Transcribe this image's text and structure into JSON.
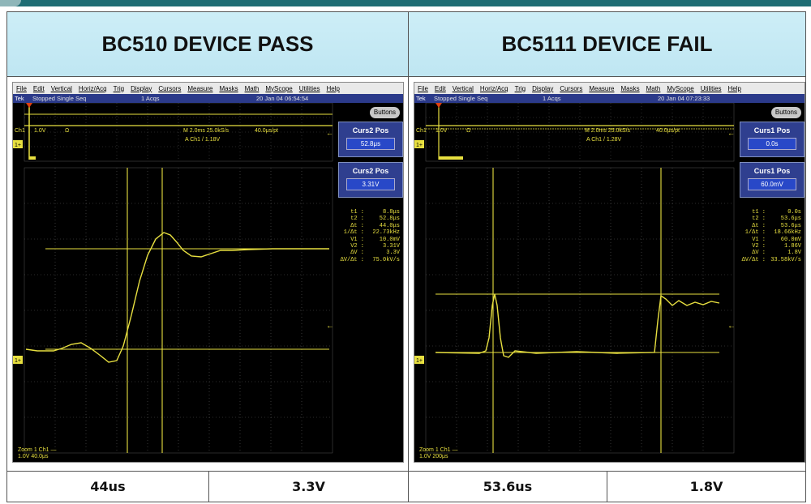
{
  "left": {
    "title": "BC510 DEVICE PASS",
    "footer": [
      "44us",
      "3.3V"
    ],
    "scope": {
      "menu": [
        "File",
        "Edit",
        "Vertical",
        "Horiz/Acq",
        "Trig",
        "Display",
        "Cursors",
        "Measure",
        "Masks",
        "Math",
        "MyScope",
        "Utilities",
        "Help"
      ],
      "status": {
        "tek": "Tek",
        "run": "Stopped Single Seq",
        "acqs": "1 Acqs",
        "date": "20 Jan 04 06:54:54"
      },
      "buttons_label": "Buttons",
      "ch_scale": "1.0V",
      "ch_coupling": "Ω",
      "timebase": "M 2.0ms 25.0kS/s",
      "res": "40.0μs/pt",
      "trigger": "A  Ch1  /  1.18V",
      "curs_boxes": [
        {
          "title": "Curs2 Pos",
          "value": "52.8μs"
        },
        {
          "title": "Curs2 Pos",
          "value": "3.31V"
        }
      ],
      "measurements": [
        [
          "t1 :",
          "8.8μs"
        ],
        [
          "t2 :",
          "52.8μs"
        ],
        [
          "Δt :",
          "44.0μs"
        ],
        [
          "1/Δt :",
          "22.73kHz"
        ],
        [
          "V1 :",
          "10.0mV"
        ],
        [
          "V2 :",
          "3.31V"
        ],
        [
          "ΔV :",
          "3.3V"
        ],
        [
          "ΔV/Δt :",
          "75.0kV/s"
        ]
      ],
      "zoom": [
        "Zoom 1   Ch1 —",
        "1.0V     40.0μs"
      ]
    }
  },
  "right": {
    "title": "BC5111 DEVICE FAIL",
    "footer": [
      "53.6us",
      "1.8V"
    ],
    "scope": {
      "menu": [
        "File",
        "Edit",
        "Vertical",
        "Horiz/Acq",
        "Trig",
        "Display",
        "Cursors",
        "Measure",
        "Masks",
        "Math",
        "MyScope",
        "Utilities",
        "Help"
      ],
      "status": {
        "tek": "Tek",
        "run": "Stopped Single Seq",
        "acqs": "1 Acqs",
        "date": "20 Jan 04 07:23:33"
      },
      "buttons_label": "Buttons",
      "ch_scale": "1.0V",
      "ch_coupling": "Ω",
      "timebase": "M 2.0ms 25.0kS/s",
      "res": "40.0μs/pt",
      "trigger": "A  Ch1  /  1.28V",
      "curs_boxes": [
        {
          "title": "Curs1 Pos",
          "value": "0.0s"
        },
        {
          "title": "Curs1 Pos",
          "value": "60.0mV"
        }
      ],
      "measurements": [
        [
          "t1 :",
          "0.0s"
        ],
        [
          "t2 :",
          "53.6μs"
        ],
        [
          "Δt :",
          "53.6μs"
        ],
        [
          "1/Δt :",
          "18.66kHz"
        ],
        [
          "V1 :",
          "60.0mV"
        ],
        [
          "V2 :",
          "1.86V"
        ],
        [
          "ΔV :",
          "1.8V"
        ],
        [
          "ΔV/Δt :",
          "33.58kV/s"
        ]
      ],
      "zoom": [
        "Zoom 1   Ch1 —",
        "1.0V     200μs"
      ]
    }
  },
  "colors": {
    "trace": "#e8e040",
    "header_bg": "#c6ebf5",
    "accent": "#1f6d74",
    "panel": "#2f3f8f"
  }
}
